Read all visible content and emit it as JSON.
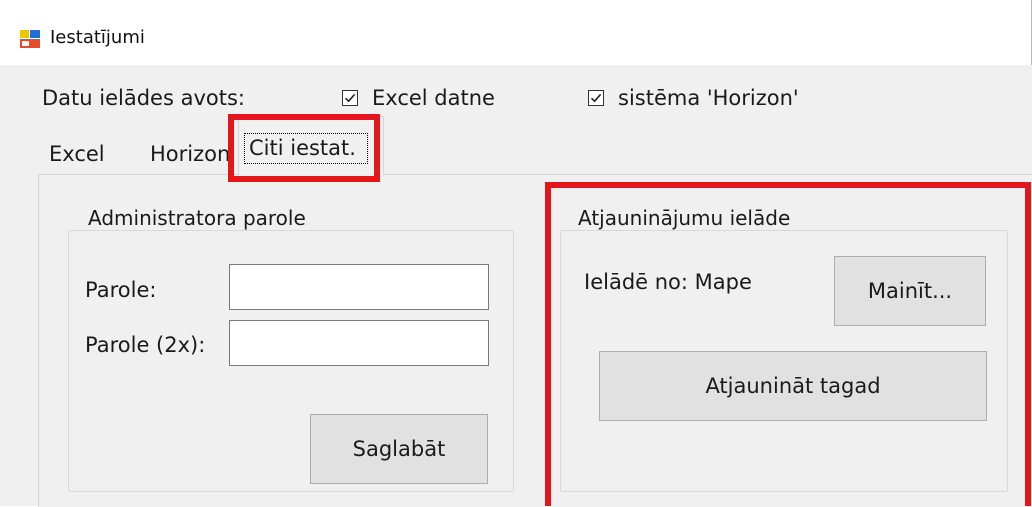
{
  "window": {
    "title": "Iestatījumi"
  },
  "source": {
    "label": "Datu ielādes avots:",
    "excel_label": "Excel datne",
    "excel_checked": true,
    "horizon_label": "sistēma 'Horizon'",
    "horizon_checked": true
  },
  "tabs": [
    "Excel",
    "Horizon",
    "Citi iestat."
  ],
  "active_tab": "Citi iestat.",
  "admin": {
    "title": "Administratora parole",
    "password_label": "Parole:",
    "password_value": "",
    "password2_label": "Parole (2x):",
    "password2_value": "",
    "save_label": "Saglabāt"
  },
  "updates": {
    "title": "Atjauninājumu ielāde",
    "source_text": "Ielādē no: Mape",
    "change_label": "Mainīt...",
    "update_now_label": "Atjaunināt tagad"
  },
  "highlight_color": "#e3161c"
}
